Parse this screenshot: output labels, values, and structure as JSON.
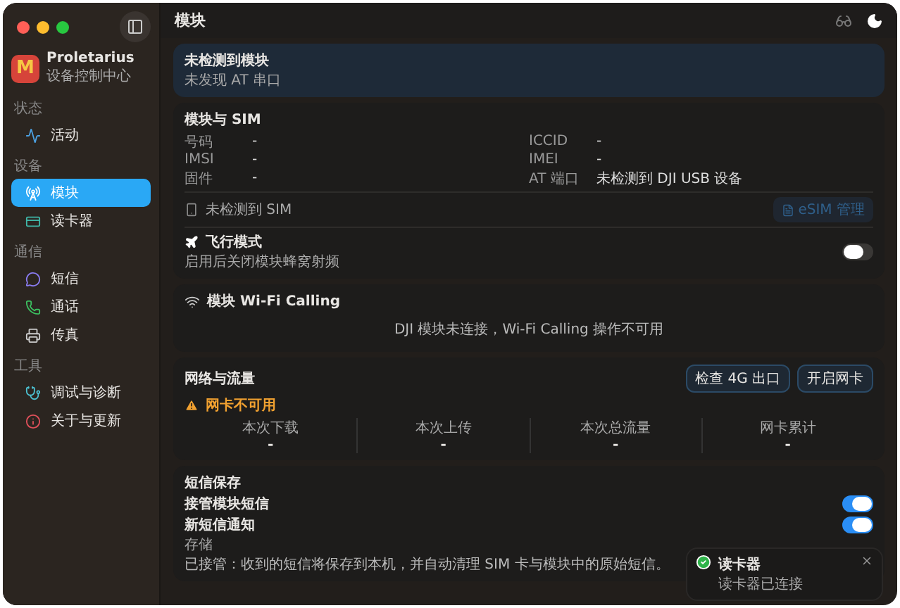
{
  "app": {
    "logo_letter": "M",
    "name": "Proletarius",
    "subtitle": "设备控制中心"
  },
  "sidebar": {
    "sections": [
      {
        "title": "状态",
        "items": [
          {
            "label": "活动",
            "selected": false
          }
        ]
      },
      {
        "title": "设备",
        "items": [
          {
            "label": "模块",
            "selected": true
          },
          {
            "label": "读卡器",
            "selected": false
          }
        ]
      },
      {
        "title": "通信",
        "items": [
          {
            "label": "短信",
            "selected": false
          },
          {
            "label": "通话",
            "selected": false
          },
          {
            "label": "传真",
            "selected": false
          }
        ]
      },
      {
        "title": "工具",
        "items": [
          {
            "label": "调试与诊断",
            "selected": false
          },
          {
            "label": "关于与更新",
            "selected": false
          }
        ]
      }
    ]
  },
  "header": {
    "title": "模块"
  },
  "banner": {
    "title": "未检测到模块",
    "subtitle": "未发现 AT 串口"
  },
  "sim_card": {
    "title": "模块与 SIM",
    "fields_left": [
      {
        "label": "号码",
        "value": "-"
      },
      {
        "label": "IMSI",
        "value": "-"
      },
      {
        "label": "固件",
        "value": "-"
      }
    ],
    "fields_right": [
      {
        "label": "ICCID",
        "value": "-"
      },
      {
        "label": "IMEI",
        "value": "-"
      },
      {
        "label": "AT 端口",
        "value": "未检测到 DJI USB 设备"
      }
    ],
    "sim_status": "未检测到 SIM",
    "esim_button": {
      "label": "eSIM 管理",
      "disabled": true
    },
    "airplane": {
      "title": "飞行模式",
      "description": "启用后关闭模块蜂窝射频",
      "on": false
    }
  },
  "wifi_calling": {
    "title": "模块 Wi-Fi Calling",
    "message": "DJI 模块未连接，Wi-Fi Calling 操作不可用"
  },
  "network": {
    "title": "网络与流量",
    "buttons": [
      "检查 4G 出口",
      "开启网卡"
    ],
    "warning": "网卡不可用",
    "stats": [
      {
        "label": "本次下载",
        "value": "-"
      },
      {
        "label": "本次上传",
        "value": "-"
      },
      {
        "label": "本次总流量",
        "value": "-"
      },
      {
        "label": "网卡累计",
        "value": "-"
      }
    ]
  },
  "sms": {
    "title": "短信保存",
    "toggles": [
      {
        "label": "接管模块短信",
        "on": true
      },
      {
        "label": "新短信通知",
        "on": true
      }
    ],
    "storage_label": "存储",
    "storage_note": "已接管：收到的短信将保存到本机，并自动清理 SIM 卡与模块中的原始短信。"
  },
  "toast": {
    "kind": "success",
    "title": "读卡器",
    "message": "读卡器已连接"
  }
}
